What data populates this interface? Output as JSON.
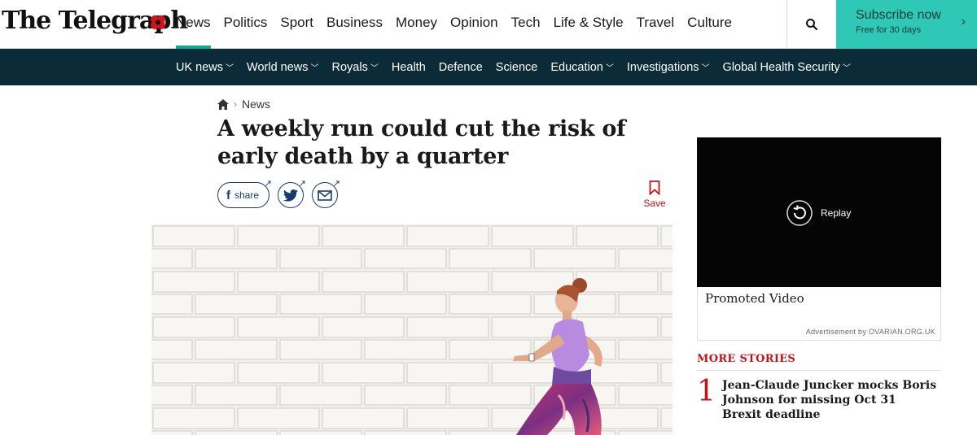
{
  "brand": {
    "logo_text": "The Telegraph",
    "accent": "#0ca999",
    "navy": "#0c2b38",
    "red": "#c4121a",
    "subscribe_bg": "#2fc7b6"
  },
  "main_nav": [
    {
      "label": "News",
      "active": true
    },
    {
      "label": "Politics"
    },
    {
      "label": "Sport"
    },
    {
      "label": "Business"
    },
    {
      "label": "Money"
    },
    {
      "label": "Opinion"
    },
    {
      "label": "Tech"
    },
    {
      "label": "Life & Style"
    },
    {
      "label": "Travel"
    },
    {
      "label": "Culture"
    }
  ],
  "search": {
    "icon": "search-icon"
  },
  "subscribe": {
    "label": "Subscribe now",
    "sub": "Free for 30 days"
  },
  "sub_nav": [
    {
      "label": "UK news",
      "dropdown": true
    },
    {
      "label": "World news",
      "dropdown": true
    },
    {
      "label": "Royals",
      "dropdown": true
    },
    {
      "label": "Health"
    },
    {
      "label": "Defence"
    },
    {
      "label": "Science"
    },
    {
      "label": "Education",
      "dropdown": true
    },
    {
      "label": "Investigations",
      "dropdown": true
    },
    {
      "label": "Global Health Security",
      "dropdown": true
    }
  ],
  "breadcrumb": {
    "section": "News"
  },
  "article": {
    "headline": "A weekly run could cut the risk of early death by a quarter",
    "share_label": "share",
    "save_label": "Save"
  },
  "sidebar": {
    "replay_label": "Replay",
    "promoted_label": "Promoted Video",
    "ad_text": "Advertisement by OVARIAN.ORG.UK",
    "more_stories_title": "MORE STORIES",
    "stories": [
      {
        "number": "1",
        "title": "Jean-Claude Juncker mocks Boris Johnson for missing Oct 31 Brexit deadline"
      }
    ]
  }
}
